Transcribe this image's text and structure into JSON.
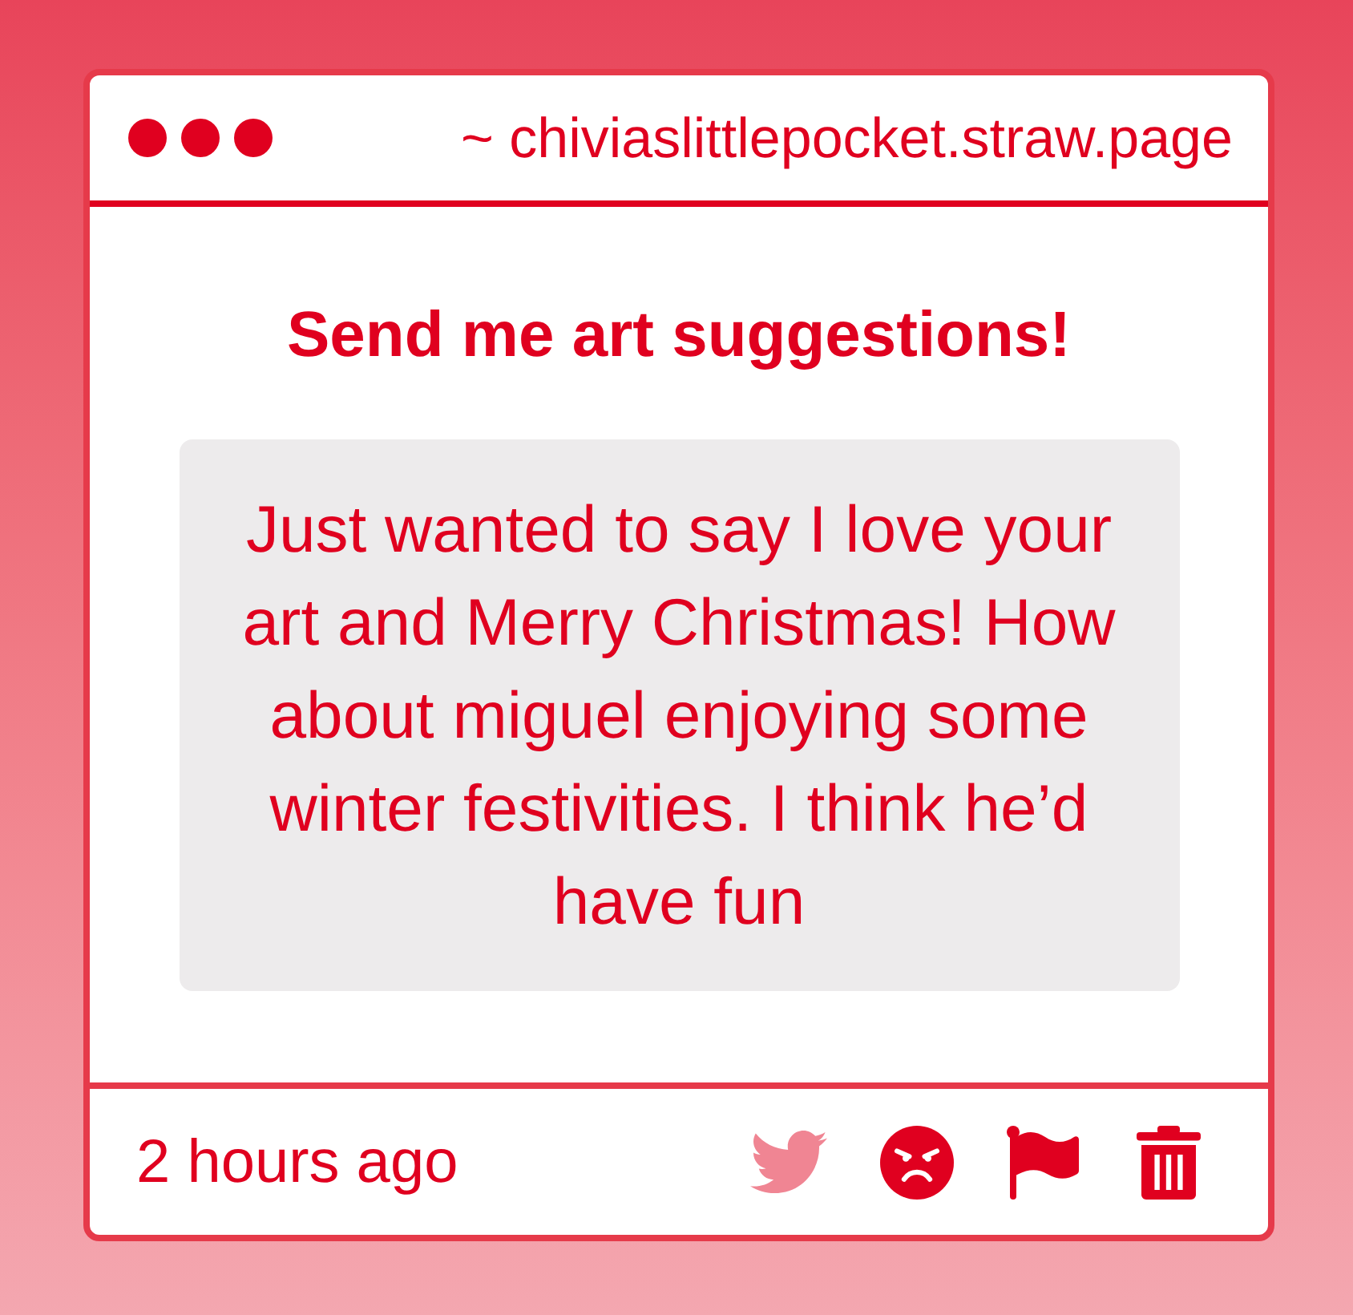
{
  "window": {
    "address": "~ chiviaslittlepocket.straw.page"
  },
  "prompt": {
    "title": "Send me art suggestions!",
    "message": "Just wanted to say I love your art and Merry Christmas! How about miguel enjoying some winter festivities. I think he’d have fun"
  },
  "footer": {
    "time": "2 hours ago",
    "actions": [
      {
        "kind": "bird",
        "disabled": true
      },
      {
        "kind": "angry-face",
        "disabled": false
      },
      {
        "kind": "flag",
        "disabled": false
      },
      {
        "kind": "trash",
        "disabled": false
      }
    ]
  }
}
